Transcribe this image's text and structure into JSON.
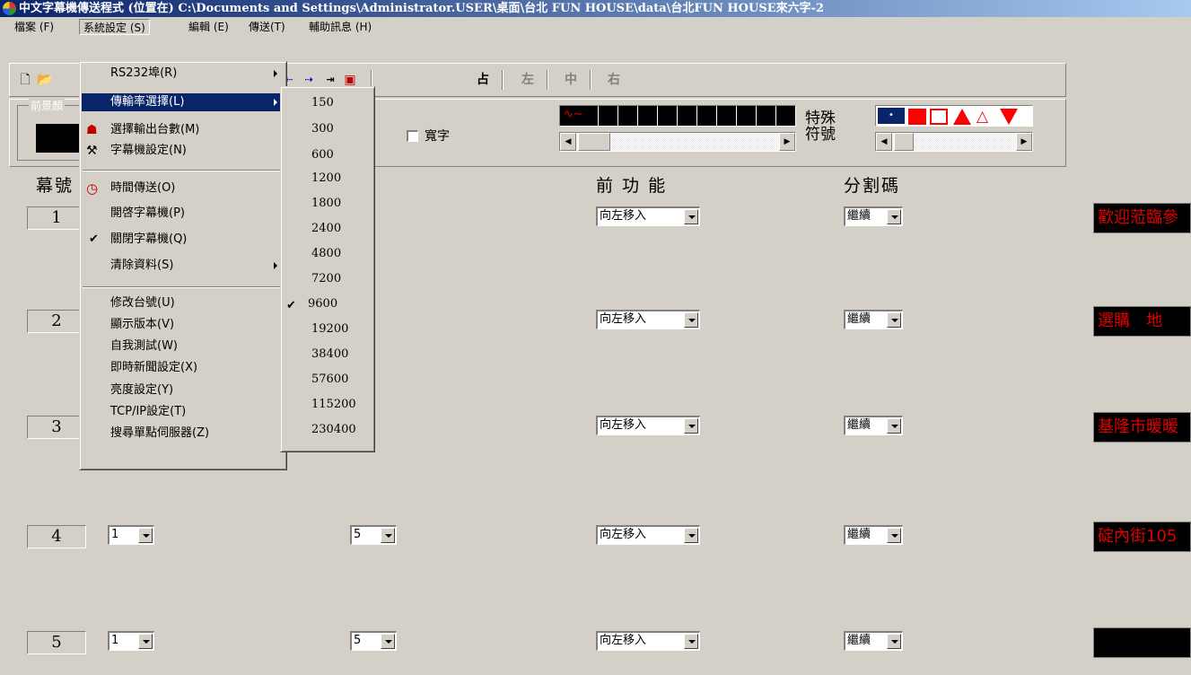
{
  "window": {
    "title": "中文字幕機傳送程式 (位置在) C:\\Documents and Settings\\Administrator.USER\\桌面\\台北 FUN HOUSE\\data\\台北FUN HOUSE來六字-2"
  },
  "menubar": {
    "items": [
      {
        "label": "檔案 (F)"
      },
      {
        "label": "系統設定 (S)"
      },
      {
        "label": "編輯 (E)"
      },
      {
        "label": "傳送(T)"
      },
      {
        "label": "輔助訊息 (H)"
      }
    ]
  },
  "toolbar": {
    "align_labels": [
      "占",
      "左",
      "中",
      "右"
    ],
    "wide_char_label": "寬字",
    "front_color_label": "前景顏",
    "special_symbol_label": "特殊符號"
  },
  "system_menu": {
    "items": [
      {
        "label": "RS232埠(R)",
        "submenu": true
      },
      {
        "label": "傳輸率選擇(L)",
        "submenu": true,
        "highlighted": true
      },
      {
        "label": "選擇輸出台數(M)",
        "icon": "people-icon"
      },
      {
        "label": "字幕機設定(N)",
        "icon": "tools-icon"
      },
      {
        "label": "時間傳送(O)",
        "icon": "clock-icon"
      },
      {
        "label": "開啓字幕機(P)"
      },
      {
        "label": "關閉字幕機(Q)",
        "checked": true
      },
      {
        "label": "清除資料(S)",
        "submenu": true
      },
      {
        "label": "修改台號(U)"
      },
      {
        "label": "顯示版本(V)"
      },
      {
        "label": "自我測試(W)"
      },
      {
        "label": "即時新聞設定(X)"
      },
      {
        "label": "亮度設定(Y)"
      },
      {
        "label": "TCP/IP設定(T)"
      },
      {
        "label": "搜尋單點伺服器(Z)"
      }
    ]
  },
  "baud_menu": {
    "items": [
      "150",
      "300",
      "600",
      "1200",
      "1800",
      "2400",
      "4800",
      "7200",
      "9600",
      "19200",
      "38400",
      "57600",
      "115200",
      "230400"
    ],
    "selected": "9600"
  },
  "table": {
    "headers": {
      "number": "幕號",
      "front_function": "前 功 能",
      "split_code": "分割碼"
    },
    "rows": [
      {
        "number": "1",
        "col1": "",
        "col2": "",
        "front_function": "向左移入",
        "split_code": "繼續",
        "preview": "歡迎蒞臨參"
      },
      {
        "number": "2",
        "col1": "",
        "col2": "",
        "front_function": "向左移入",
        "split_code": "繼續",
        "preview": "選購　地"
      },
      {
        "number": "3",
        "col1": "",
        "col2": "",
        "front_function": "向左移入",
        "split_code": "繼續",
        "preview": "基隆市暖暖"
      },
      {
        "number": "4",
        "col1": "1",
        "col2": "5",
        "front_function": "向左移入",
        "split_code": "繼續",
        "preview": "碇內街105"
      },
      {
        "number": "5",
        "col1": "1",
        "col2": "5",
        "front_function": "向左移入",
        "split_code": "繼續",
        "preview": ""
      }
    ]
  },
  "colors": {
    "title_bar": "#0a246a",
    "highlight": "#0a246a",
    "led_text": "#e00000",
    "led_background": "#000000",
    "symbol_red": "#ff0000"
  }
}
